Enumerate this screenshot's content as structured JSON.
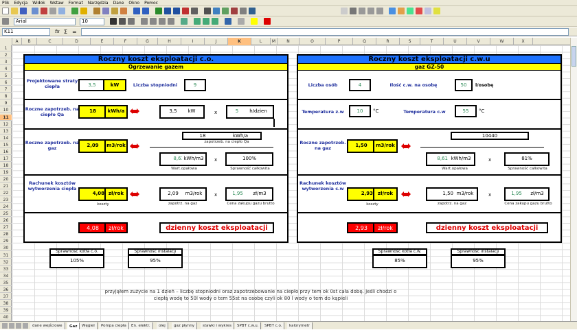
{
  "menu": [
    "Plik",
    "Edycja",
    "Widok",
    "Wstaw",
    "Format",
    "Narzędzia",
    "Dane",
    "Okno",
    "Pomoc"
  ],
  "toolbar": {
    "font_name": "Arial",
    "font_size": "10",
    "cell_ref": "K11",
    "fx_label": "fx"
  },
  "columns": [
    "A",
    "B",
    "C",
    "D",
    "E",
    "F",
    "G",
    "H",
    "I",
    "J",
    "K",
    "L",
    "M",
    "N",
    "O",
    "P",
    "Q",
    "R",
    "S",
    "T",
    "U",
    "V",
    "W",
    "X"
  ],
  "rows": [
    "1",
    "2",
    "3",
    "4",
    "5",
    "6",
    "7",
    "8",
    "9",
    "10",
    "11",
    "12",
    "13",
    "14",
    "15",
    "16",
    "17",
    "18",
    "19",
    "20",
    "21",
    "22",
    "23",
    "24",
    "25",
    "26",
    "27",
    "28",
    "29",
    "30",
    "31",
    "32",
    "33",
    "34",
    "35",
    "36",
    "37",
    "38",
    "39",
    "40"
  ],
  "left": {
    "title": "Roczny koszt eksploatacji c.o.",
    "subtitle": "Ogrzewanie gazem",
    "proj_label": "Projektowane straty ciepła",
    "proj_value": "3,5",
    "proj_unit": "kW",
    "liczba_label": "Liczba stopniodni",
    "liczba_value": "9",
    "roczne_ciepla_label": "Roczne zapotrzeb. na ciepło Qa",
    "roczne_ciepla_value": "18",
    "roczne_ciepla_unit": "kWh/a",
    "calc_kw": "3,5",
    "calc_kw_unit": "kW",
    "times": "x",
    "calc_h": "5",
    "calc_h_unit": "h/dzien",
    "roczne_gaz_label": "Roczne zapotrzeb. na gaz",
    "roczne_gaz_value": "2,09",
    "roczne_gaz_unit": "m3/rok",
    "frac_top": "18",
    "frac_top_unit": "kWh/a",
    "frac_caption": "zapotrzeb. na ciepło Qa",
    "wart_value": "8,61",
    "wart_unit": "kWh/m3",
    "spraw_value": "100%",
    "wart_caption": "Wart.opałowa",
    "spraw_caption": "Sprawność całkowita",
    "rachunek_label": "Rachunek kosztów wytworzenia ciepła",
    "koszt_value": "4,08",
    "koszt_unit": "zł/rok",
    "koszty_caption": "koszty",
    "zap_value": "2,09",
    "zap_unit": "m3/rok",
    "cena_value": "1,95",
    "cena_unit": "zł/m3",
    "zap_caption": "zapotrz. na gaz",
    "cena_caption": "Cena zakupu gazu brutto",
    "result_value": "4,08",
    "result_unit": "zł/rok",
    "result_title": "dzienny koszt eksploatacji",
    "kotla_label": "Sprawność kotła c.o.",
    "kotla_value": "105%",
    "inst_label": "Sprawność instalacji",
    "inst_value": "95%"
  },
  "right": {
    "title": "Roczny koszt eksploatacji c.w.u",
    "subtitle": "gaz GZ-50",
    "osob_label": "Liczba osób",
    "osob_value": "4",
    "ilosc_label": "Ilość c.w. na osobę",
    "ilosc_value": "50",
    "ilosc_unit": "l/osobę",
    "temp_zw_label": "Temperatura z.w",
    "temp_zw_value": "10",
    "temp_unit": "°C",
    "temp_cw_label": "Temperatura c.w",
    "temp_cw_value": "55",
    "roczne_gaz_label": "Roczne zapotrzeb. na gaz",
    "roczne_gaz_value": "1,50",
    "roczne_gaz_unit": "m3/rok",
    "frac_top": "10440",
    "wart_value": "8,61",
    "wart_unit": "kWh/m3",
    "spraw_value": "81%",
    "times": "x",
    "wart_caption": "Wart.opałowa",
    "spraw_caption": "Sprawność całkowita",
    "rachunek_label": "Rachunek kosztów wytworzenia c.w",
    "koszt_value": "2,93",
    "koszt_unit": "zł/rok",
    "koszty_caption": "koszty",
    "zap_value": "1,50",
    "zap_unit": "m3/rok",
    "cena_value": "1,95",
    "cena_unit": "zł/m3",
    "zap_caption": "zapotrz. na gaz",
    "cena_caption": "Cena zakupu gazu brutto",
    "result_value": "2,93",
    "result_unit": "zł/rok",
    "result_title": "dzienny koszt eksploatacji",
    "kotla_label": "Sprawność kotła c.w.",
    "kotla_value": "85%",
    "inst_label": "Sprawność instalacji",
    "inst_value": "95%"
  },
  "comment": "przyjąłem zużycie na 1 dzień – liczbę stopniodni oraz zapotrzebowanie na ciepło przy tem ok 0st cała dobę. Jeśli chodzi o ciepłą wodę to 50l wody o tem 55st na osobę czyli ok 80 l wody o tem do kąpieli",
  "tabs": [
    "dane wejściowe",
    "Gaz",
    "Węgiel",
    "Pompa ciepła",
    "En. elektr.",
    "olej",
    "gaz płynny",
    "stawki i wykres",
    "SPBT c.w.u.",
    "SPBT c.o.",
    "kalorymetr"
  ],
  "colors": {
    "title_blue": "#1e73ff",
    "yellow": "#ffff00",
    "red": "#ff0000",
    "label_blue": "#1c2c9c"
  }
}
